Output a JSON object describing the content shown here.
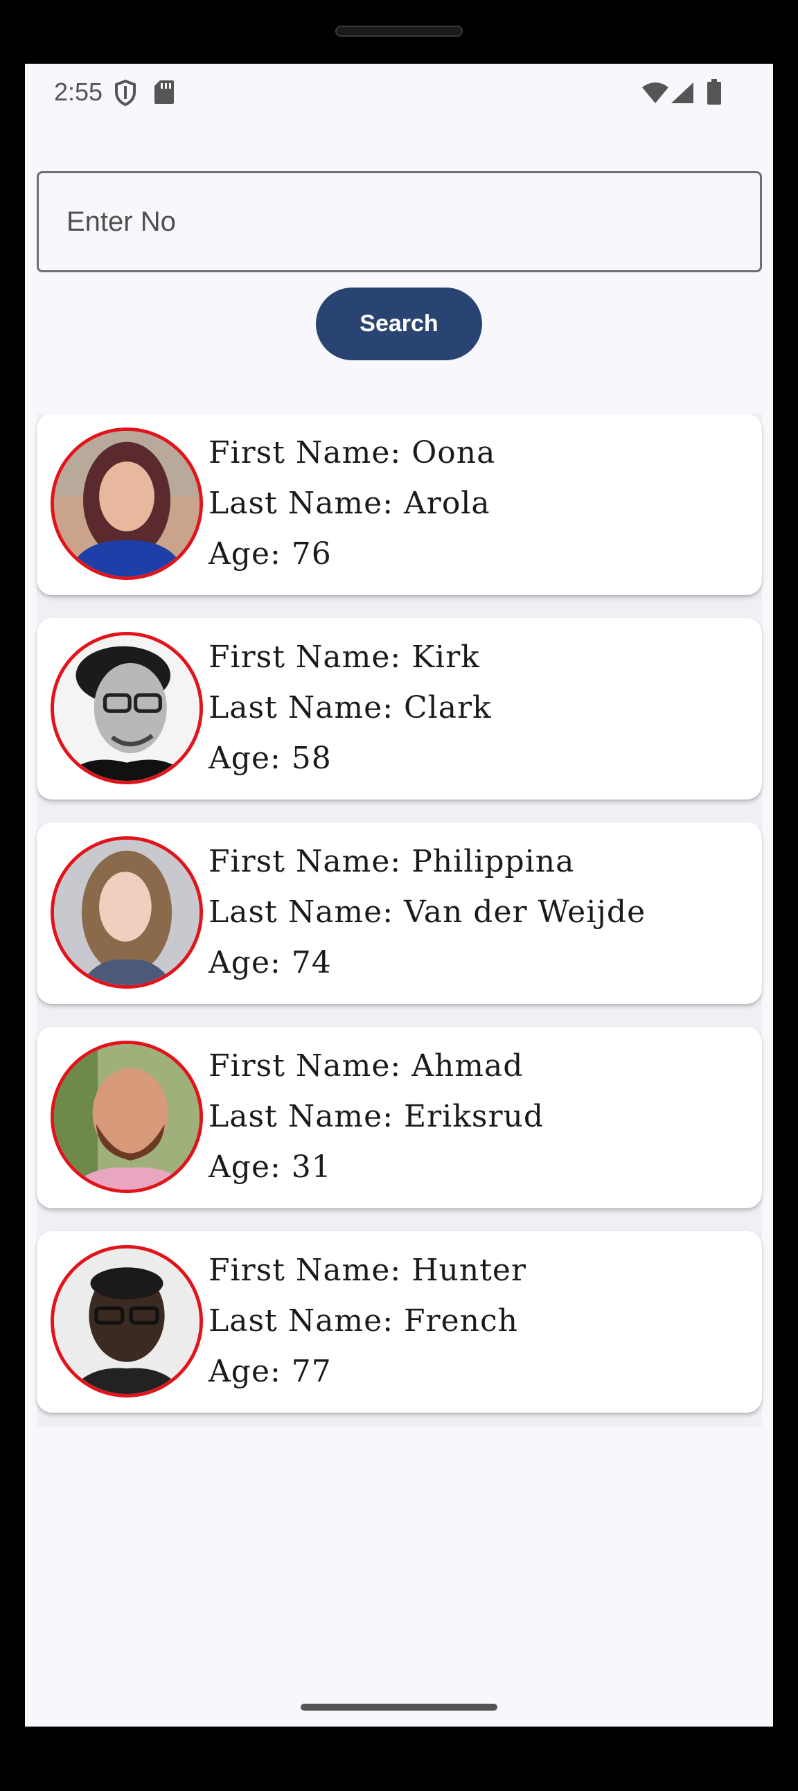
{
  "status_bar": {
    "time": "2:55",
    "icons": [
      "shield-icon",
      "sd-card-icon",
      "wifi-icon",
      "signal-icon",
      "battery-icon"
    ]
  },
  "search": {
    "placeholder": "Enter No",
    "button_label": "Search"
  },
  "people": [
    {
      "first_line": "First Name: Oona",
      "last_line": "Last Name: Arola",
      "age_line": "Age: 76"
    },
    {
      "first_line": "First Name: Kirk",
      "last_line": "Last Name: Clark",
      "age_line": "Age: 58"
    },
    {
      "first_line": "First Name: Philippina",
      "last_line": "Last Name: Van der Weijde",
      "age_line": "Age: 74"
    },
    {
      "first_line": "First Name: Ahmad",
      "last_line": "Last Name: Eriksrud",
      "age_line": "Age: 31"
    },
    {
      "first_line": "First Name: Hunter",
      "last_line": "Last Name: French",
      "age_line": "Age: 77"
    }
  ],
  "colors": {
    "accent": "#294372",
    "avatar_ring": "#e0141a",
    "background": "#f7f7fc"
  }
}
